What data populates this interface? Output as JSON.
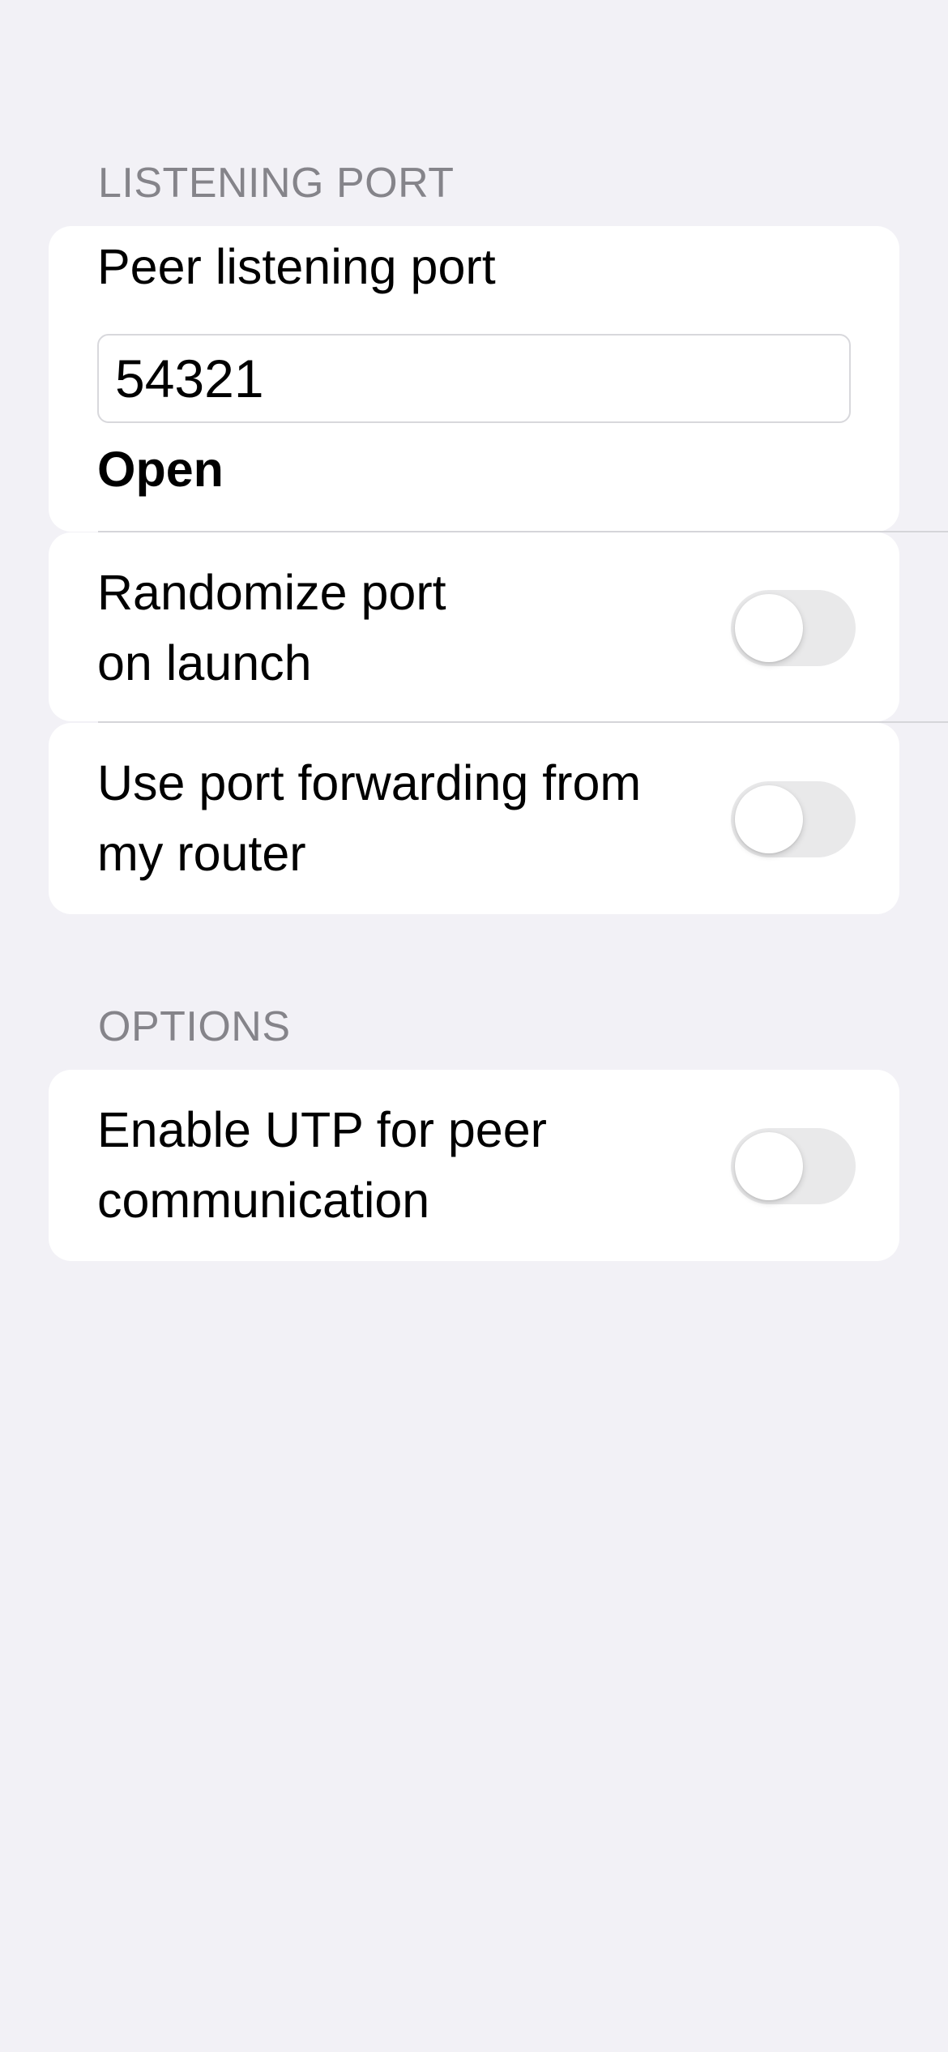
{
  "sections": {
    "listening_port": {
      "header": "LISTENING PORT",
      "peer_port_label": "Peer listening port",
      "peer_port_value": "54321",
      "port_status": "Open",
      "randomize_label_line1": "Randomize port",
      "randomize_label_line2": "on launch",
      "randomize_enabled": false,
      "port_forwarding_label_line1": "Use port forwarding from",
      "port_forwarding_label_line2": "my router",
      "port_forwarding_enabled": false
    },
    "options": {
      "header": "OPTIONS",
      "utp_label_line1": "Enable UTP for peer",
      "utp_label_line2": "communication",
      "utp_enabled": false
    }
  },
  "colors": {
    "background": "#F2F1F6",
    "card": "#FFFFFF",
    "header_text": "#85848A",
    "toggle_off": "#E9E9EA"
  }
}
